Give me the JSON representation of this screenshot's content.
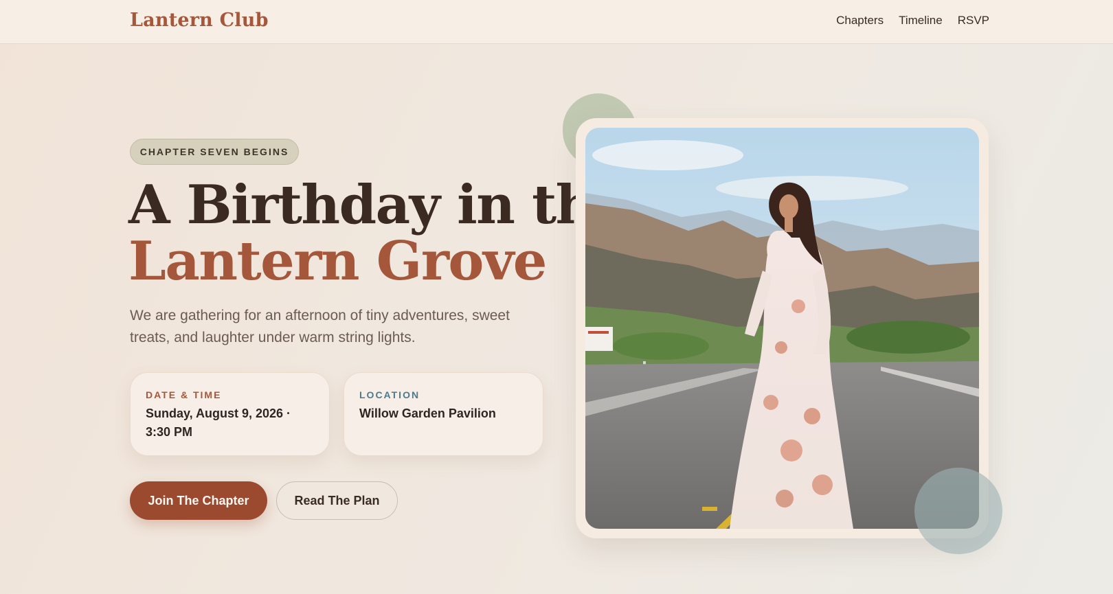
{
  "header": {
    "brand": "Lantern Club",
    "nav": [
      "Chapters",
      "Timeline",
      "RSVP"
    ]
  },
  "hero": {
    "badge": "CHAPTER SEVEN BEGINS",
    "title_line1": "A Birthday in the",
    "title_line2": "Lantern Grove",
    "lead": "We are gathering for an afternoon of tiny adventures, sweet treats, and laughter under warm string lights.",
    "cards": [
      {
        "label": "DATE & TIME",
        "value": "Sunday, August 9, 2026 · 3:30 PM"
      },
      {
        "label": "LOCATION",
        "value": "Willow Garden Pavilion"
      }
    ],
    "primary_cta": "Join The Chapter",
    "secondary_cta": "Read The Plan"
  },
  "photo": {
    "icon": "portrait-photo"
  },
  "colors": {
    "accent": "#a4573a",
    "primary_button": "#9b4a2f",
    "location_label": "#4b7a8c",
    "badge_bg": "#d6d1bd"
  }
}
